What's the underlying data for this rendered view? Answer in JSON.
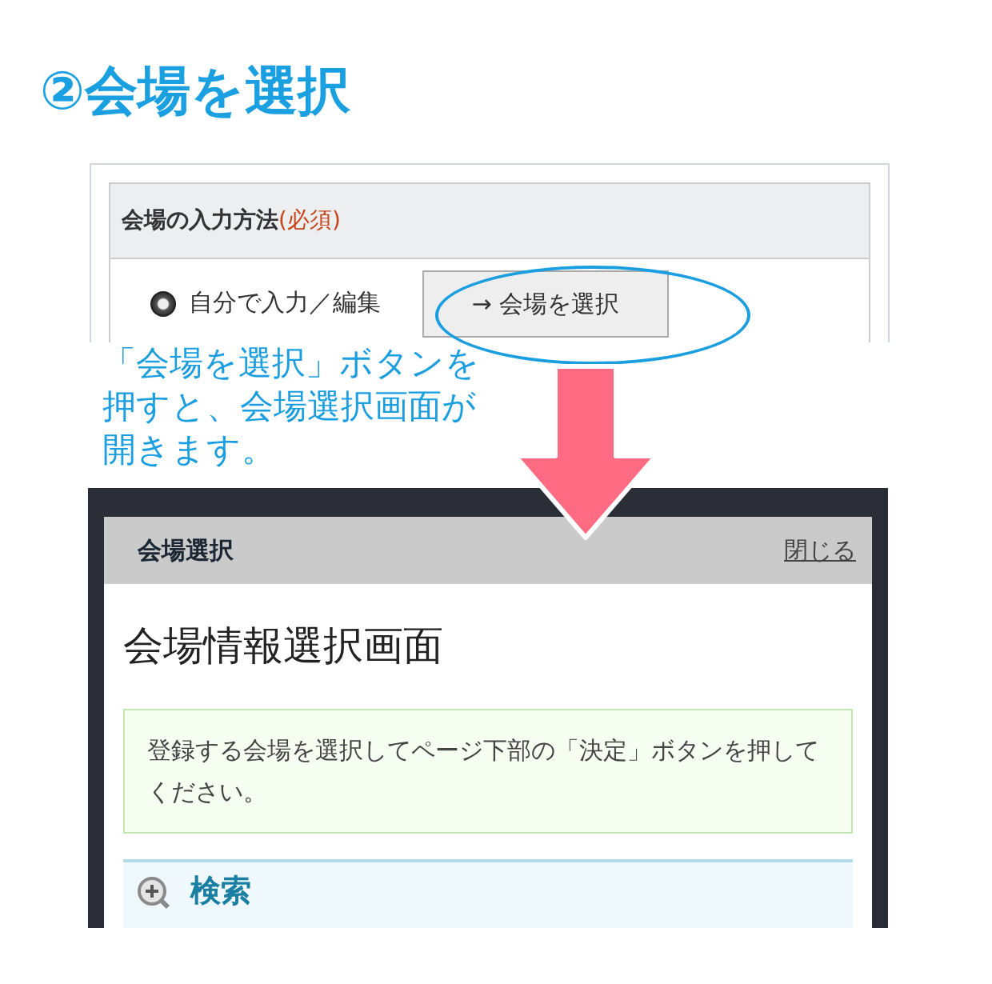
{
  "heading": "②会場を選択",
  "form_panel": {
    "header": {
      "label": "会場の入力方法",
      "required": "(必須)"
    },
    "radio": {
      "label": "自分で入力／編集",
      "checked": true
    },
    "button": "→ 会場を選択"
  },
  "callout": "「会場を選択」ボタンを押すと、会場選択画面が開きます。",
  "dialog": {
    "title": "会場選択",
    "close_link": "閉じる",
    "page_title": "会場情報選択画面",
    "notice": "登録する会場を選択してページ下部の「決定」ボタンを押してください。",
    "search_section": {
      "label": "検索",
      "expanded": false
    }
  }
}
